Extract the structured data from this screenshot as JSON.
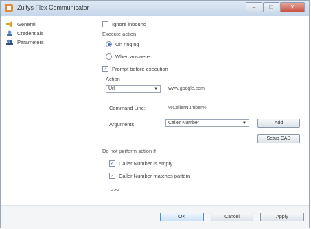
{
  "window": {
    "title": "Zultys Flex Communicator"
  },
  "sidebar": {
    "items": [
      {
        "label": "General",
        "icon": "general-icon"
      },
      {
        "label": "Credentials",
        "icon": "credentials-icon"
      },
      {
        "label": "Parameters",
        "icon": "parameters-icon"
      }
    ]
  },
  "panel": {
    "ignore_inbound": {
      "label": "Ignore inbound",
      "checked": false
    },
    "execute_action_heading": "Execute action",
    "on_ringing": {
      "label": "On ringing",
      "selected": true
    },
    "when_answered": {
      "label": "When answered",
      "selected": false
    },
    "prompt_before": {
      "label": "Prompt before execution",
      "checked": true
    },
    "action_heading": "Action",
    "action_type": {
      "value": "Url"
    },
    "action_url": "www.google.com",
    "command_line_label": "Command Line:",
    "command_line_value": "%CallerNumber%",
    "arguments_label": "Arguments:",
    "arguments_select": {
      "value": "Caller Number"
    },
    "add_label": "Add",
    "setup_cad_label": "Setup CAD",
    "not_perform_heading": "Do not perform action if",
    "caller_empty": {
      "label": "Caller Number is empty",
      "checked": true
    },
    "caller_matches": {
      "label": "Caller Number matches pattern",
      "checked": true
    },
    "more_label": ">>>"
  },
  "footer": {
    "ok_label": "OK",
    "cancel_label": "Cancel",
    "apply_label": "Apply"
  },
  "colors": {
    "accent": "#3d6fc0",
    "titlebar": "#c6d7ea"
  }
}
